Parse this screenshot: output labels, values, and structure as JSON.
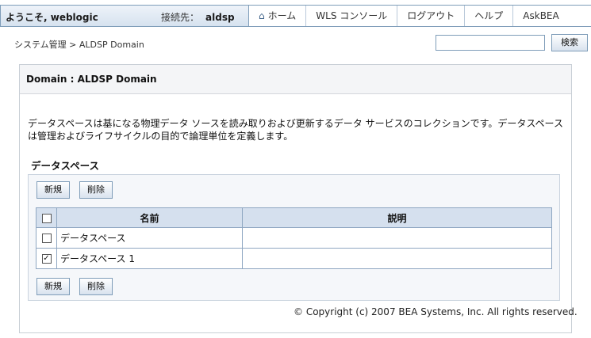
{
  "header": {
    "welcome": "ようこそ, weblogic",
    "connection_label": "接続先：",
    "connection_value": "aldsp",
    "nav": [
      "ホーム",
      "WLS コンソール",
      "ログアウト",
      "ヘルプ",
      "AskBEA"
    ]
  },
  "breadcrumb": "システム管理 > ALDSP Domain",
  "search": {
    "value": "",
    "button": "検索"
  },
  "panel": {
    "title": "Domain : ALDSP Domain",
    "description": "データスペースは基になる物理データ ソースを読み取りおよび更新するデータ サービスのコレクションです。データスペースは管理およびライフサイクルの目的で論理単位を定義します。",
    "section_title": "データスペース",
    "new_button": "新規",
    "delete_button": "削除",
    "table": {
      "headers": [
        "名前",
        "説明"
      ],
      "rows": [
        {
          "name": "データスペース",
          "description": "",
          "checked": false
        },
        {
          "name": "データスペース 1",
          "description": "",
          "checked": true
        }
      ]
    }
  },
  "copyright": "© Copyright (c) 2007 BEA Systems, Inc. All rights reserved."
}
